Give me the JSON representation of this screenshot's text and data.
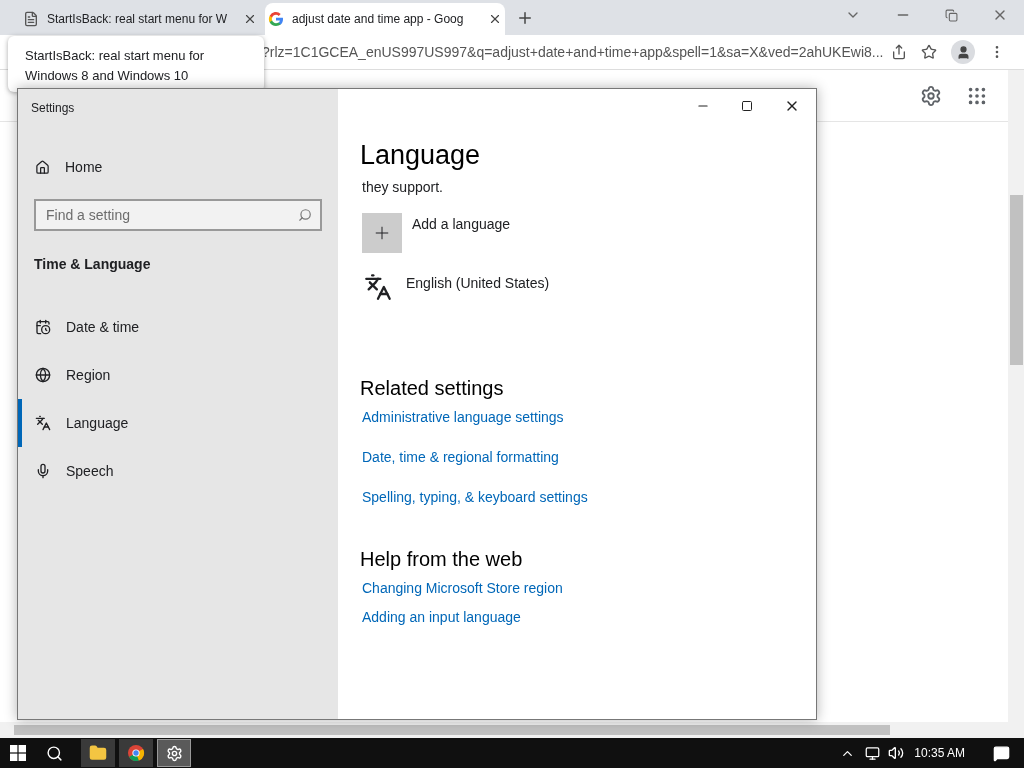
{
  "browser": {
    "tabs": [
      {
        "title": "StartIsBack: real start menu for W",
        "kind": "page",
        "selected": false
      },
      {
        "title": "adjust date and time app - Goog",
        "kind": "search",
        "selected": true
      }
    ],
    "address": "?rlz=1C1GCEA_enUS997US997&q=adjust+date+and+time+app&spell=1&sa=X&ved=2ahUKEwi8...",
    "tooltip": "StartIsBack: real start menu for Windows 8 and Windows 10"
  },
  "settings": {
    "title": "Settings",
    "home": "Home",
    "search_placeholder": "Find a setting",
    "section": "Time & Language",
    "nav": [
      {
        "label": "Date & time",
        "selected": false
      },
      {
        "label": "Region",
        "selected": false
      },
      {
        "label": "Language",
        "selected": true
      },
      {
        "label": "Speech",
        "selected": false
      }
    ],
    "page_title": "Language",
    "description": "they support.",
    "add_language": "Add a language",
    "languages": [
      {
        "name": "English (United States)"
      }
    ],
    "groups": [
      {
        "heading": "Related settings",
        "links": [
          "Administrative language settings",
          "Date, time & regional formatting",
          "Spelling, typing, & keyboard settings"
        ]
      },
      {
        "heading": "Help from the web",
        "links": [
          "Changing Microsoft Store region",
          "Adding an input language"
        ]
      }
    ]
  },
  "taskbar": {
    "apps": [
      {
        "kind": "explorer",
        "selected": false
      },
      {
        "kind": "chrome",
        "selected": false
      },
      {
        "kind": "settings",
        "selected": true
      }
    ],
    "time": "10:35 AM"
  }
}
